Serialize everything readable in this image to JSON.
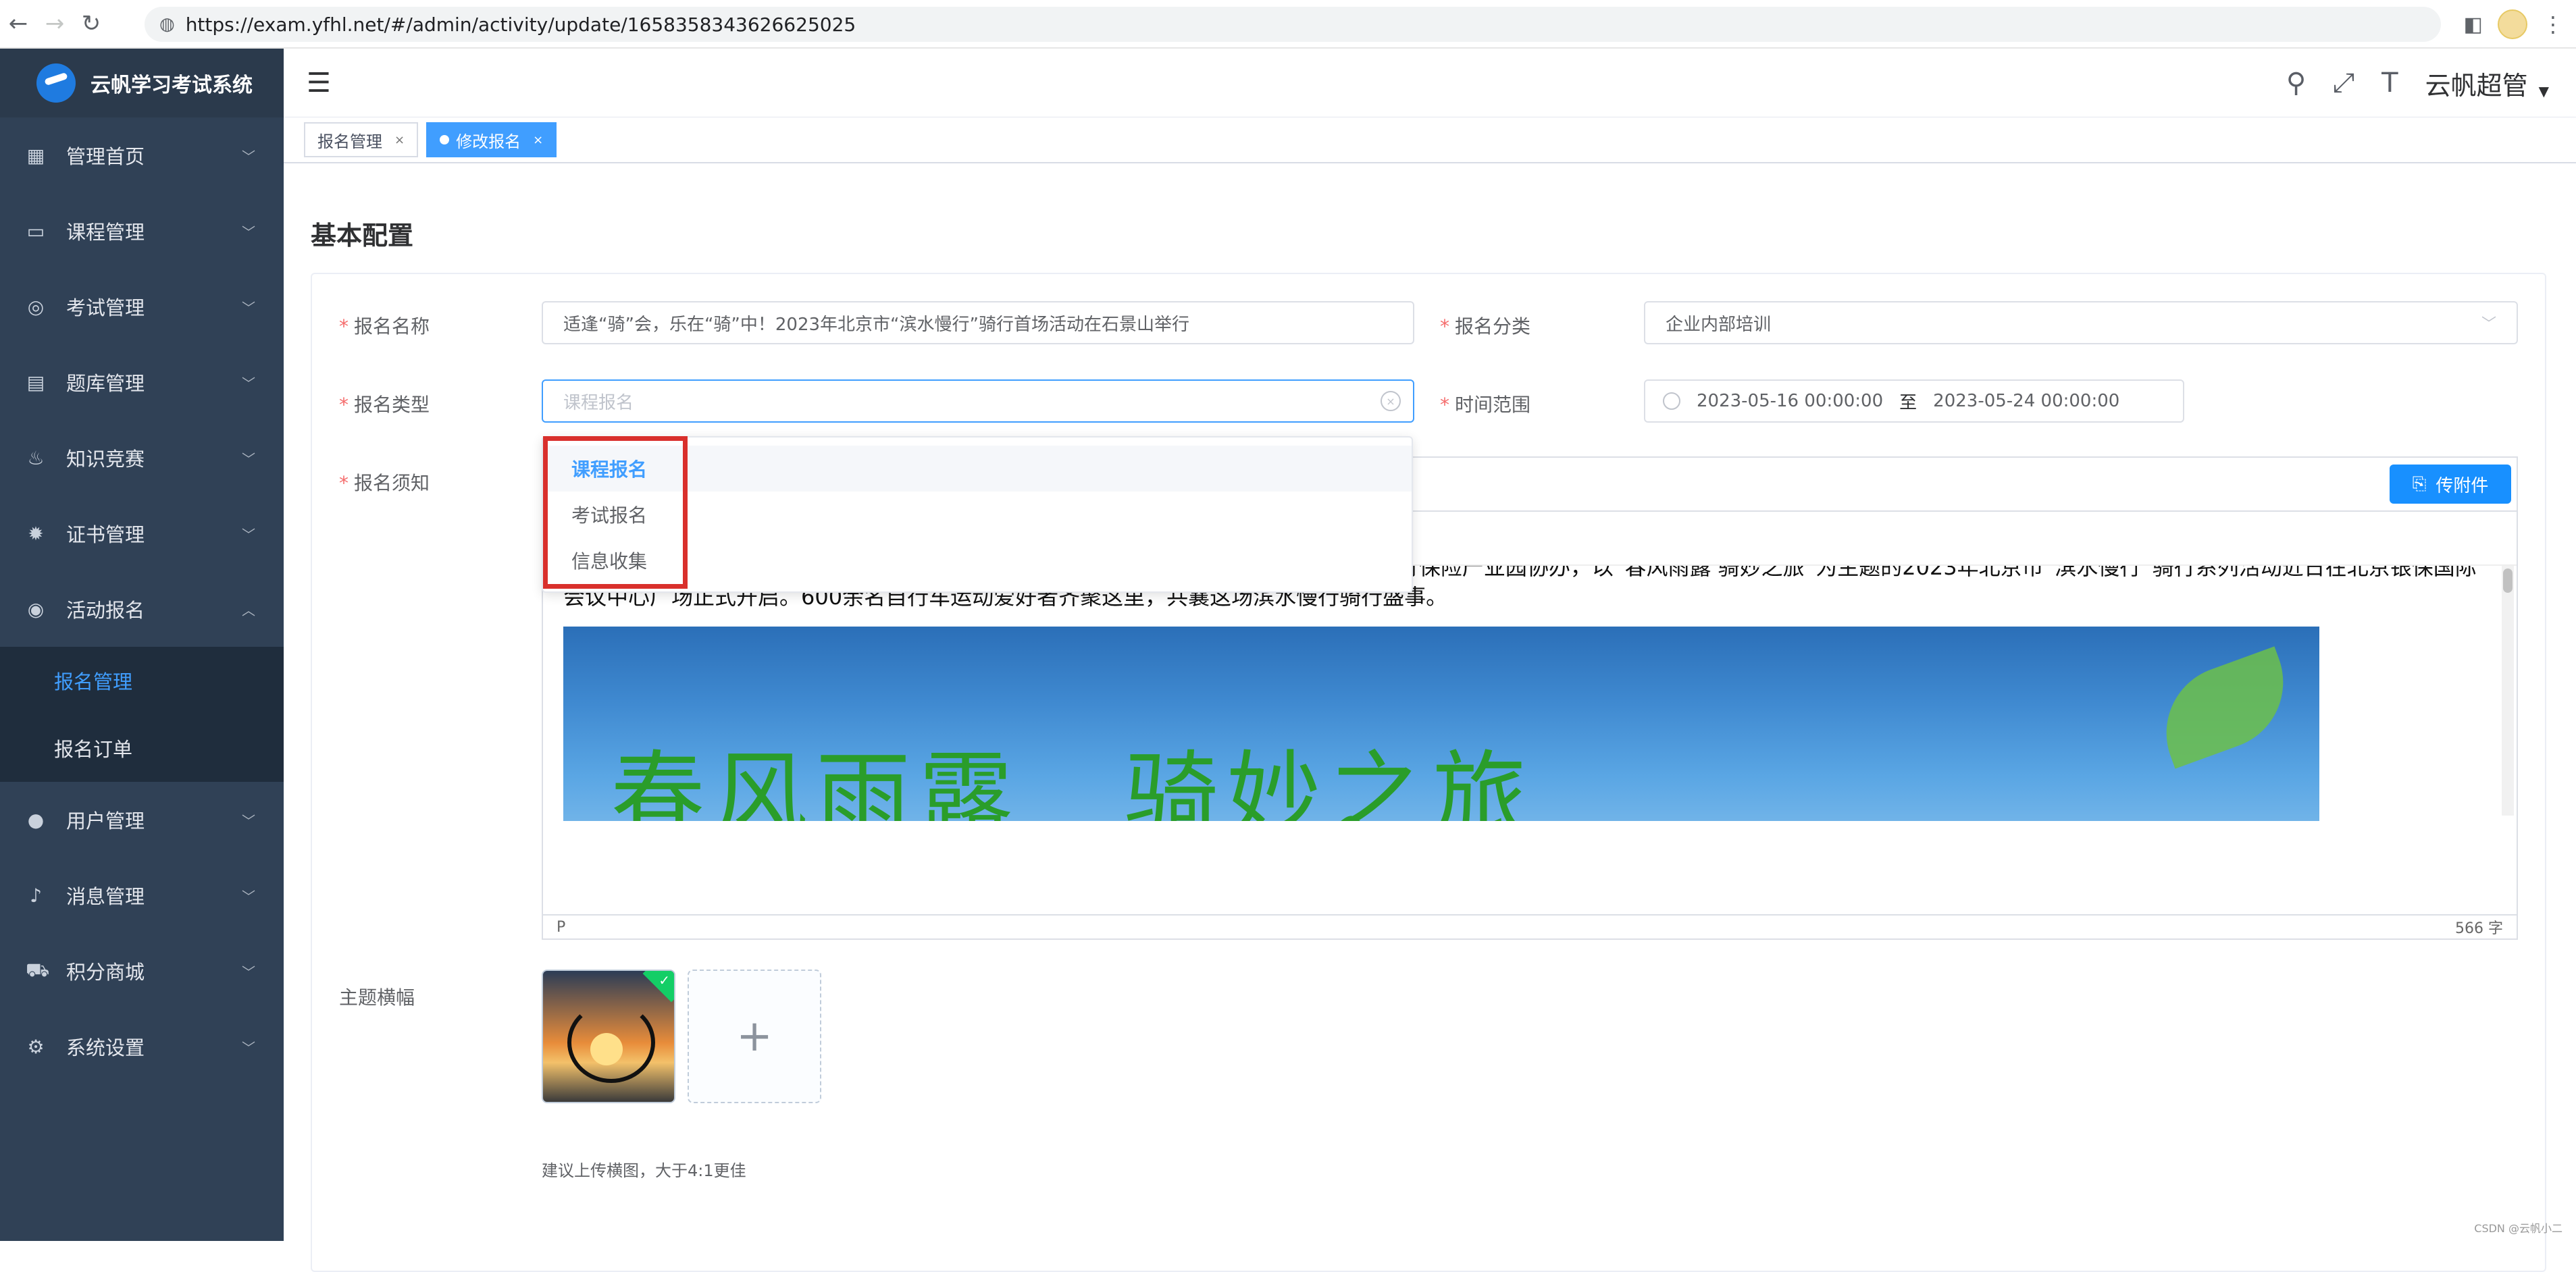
{
  "browser": {
    "url": "https://exam.yfhl.net/#/admin/activity/update/1658358343626625025"
  },
  "sidebar": {
    "logo_title": "云帆学习考试系统",
    "items": [
      {
        "label": "管理首页",
        "icon": "dashboard-icon"
      },
      {
        "label": "课程管理",
        "icon": "course-icon"
      },
      {
        "label": "考试管理",
        "icon": "exam-icon"
      },
      {
        "label": "题库管理",
        "icon": "question-bank-icon"
      },
      {
        "label": "知识竞赛",
        "icon": "fire-icon"
      },
      {
        "label": "证书管理",
        "icon": "certificate-icon"
      },
      {
        "label": "活动报名",
        "icon": "activity-icon"
      }
    ],
    "submenu": [
      {
        "label": "报名管理",
        "active": true
      },
      {
        "label": "报名订单",
        "active": false
      }
    ],
    "items_after": [
      {
        "label": "用户管理",
        "icon": "user-icon"
      },
      {
        "label": "消息管理",
        "icon": "bell-icon"
      },
      {
        "label": "积分商城",
        "icon": "cart-icon"
      },
      {
        "label": "系统设置",
        "icon": "gear-icon"
      }
    ]
  },
  "header": {
    "user_name": "云帆超管"
  },
  "tags": [
    {
      "label": "报名管理",
      "active": false
    },
    {
      "label": "修改报名",
      "active": true
    }
  ],
  "page": {
    "section_title": "基本配置"
  },
  "form": {
    "name_label": "报名名称",
    "name_value": "适逢“骑”会，乐在“骑”中！2023年北京市“滨水慢行”骑行首场活动在石景山举行",
    "category_label": "报名分类",
    "category_value": "企业内部培训",
    "type_label": "报名类型",
    "type_placeholder": "课程报名",
    "time_label": "时间范围",
    "time_start": "2023-05-16 00:00:00",
    "time_sep": "至",
    "time_end": "2023-05-24 00:00:00",
    "notice_label": "报名须知",
    "banner_label": "主题横幅",
    "banner_tip": "建议上传横图，大于4:1更佳"
  },
  "dropdown": {
    "options": [
      "课程报名",
      "考试报名",
      "信息收集"
    ],
    "selected_index": 0
  },
  "editor": {
    "attach_button": "传附件",
    "paragraph": "由北京市体育总会主办，北京市体育总会秘书处、北京市自行车运动协会承办，北京•银行保险产业园协办，以“春风雨露 骑妙之旅”为主题的2023年北京市“滨水慢行”骑行系列活动近日在北京银保国际会议中心广场正式开启。600余名自行车运动爱好者齐聚这里，共襄这场滨水慢行骑行盛事。",
    "image_text": "春风雨露　骑妙之旅",
    "status_path": "P",
    "word_count": "566 字"
  },
  "watermark": "CSDN @云帆小二",
  "colors": {
    "primary": "#409eff",
    "sidebar_bg": "#304156",
    "required": "#f56c6c",
    "highlight": "#d9302c"
  }
}
